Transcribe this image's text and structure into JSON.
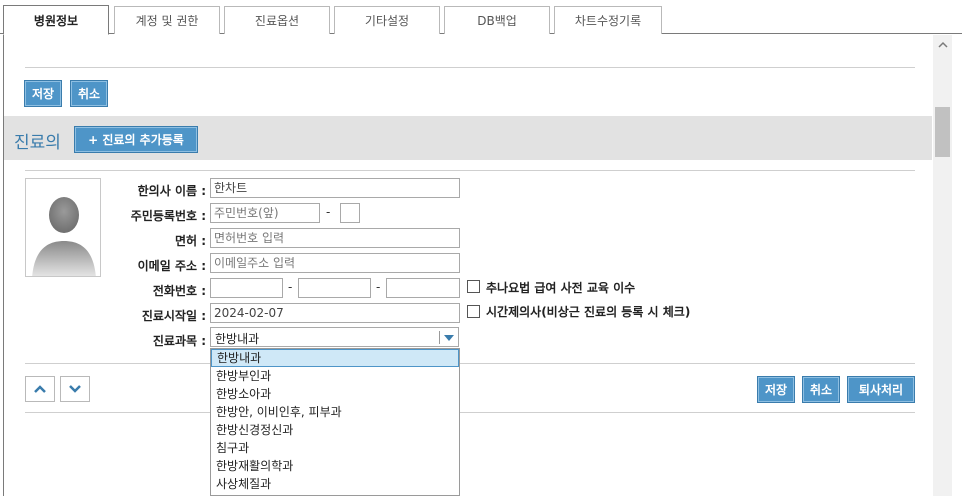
{
  "tabs": [
    {
      "label": "병원정보",
      "active": true
    },
    {
      "label": "계정 및 권한",
      "active": false
    },
    {
      "label": "진료옵션",
      "active": false
    },
    {
      "label": "기타설정",
      "active": false
    },
    {
      "label": "DB백업",
      "active": false
    },
    {
      "label": "차트수정기록",
      "active": false
    }
  ],
  "toolbar": {
    "save_label": "저장",
    "cancel_label": "취소"
  },
  "section": {
    "title": "진료의",
    "add_button_label": "+ 진료의 추가등록"
  },
  "form": {
    "doctor_name": {
      "label": "한의사 이름 :",
      "value": "한차트"
    },
    "resident_number": {
      "label": "주민등록번호 :",
      "placeholder": "주민번호(앞)",
      "separator": "-"
    },
    "license": {
      "label": "면허 :",
      "placeholder": "면허번호 입력"
    },
    "email": {
      "label": "이메일 주소 :",
      "placeholder": "이메일주소 입력"
    },
    "phone": {
      "label": "전화번호 :",
      "separator": "-"
    },
    "start_date": {
      "label": "진료시작일 :",
      "value": "2024-02-07"
    },
    "department": {
      "label": "진료과목 :",
      "selected": "한방내과"
    },
    "chuna_checkbox_label": "추나요법 급여 사전 교육 이수",
    "parttime_checkbox_label": "시간제의사(비상근 진료의 등록 시 체크)"
  },
  "dropdown_options": [
    "한방내과",
    "한방부인과",
    "한방소아과",
    "한방안, 이비인후, 피부과",
    "한방신경정신과",
    "침구과",
    "한방재활의학과",
    "사상체질과"
  ],
  "bottom_actions": {
    "save_label": "저장",
    "cancel_label": "취소",
    "retire_label": "퇴사처리"
  },
  "colors": {
    "accent": "#4e95c8",
    "section_bg": "#e2e2e2",
    "section_title": "#3a7cac"
  }
}
